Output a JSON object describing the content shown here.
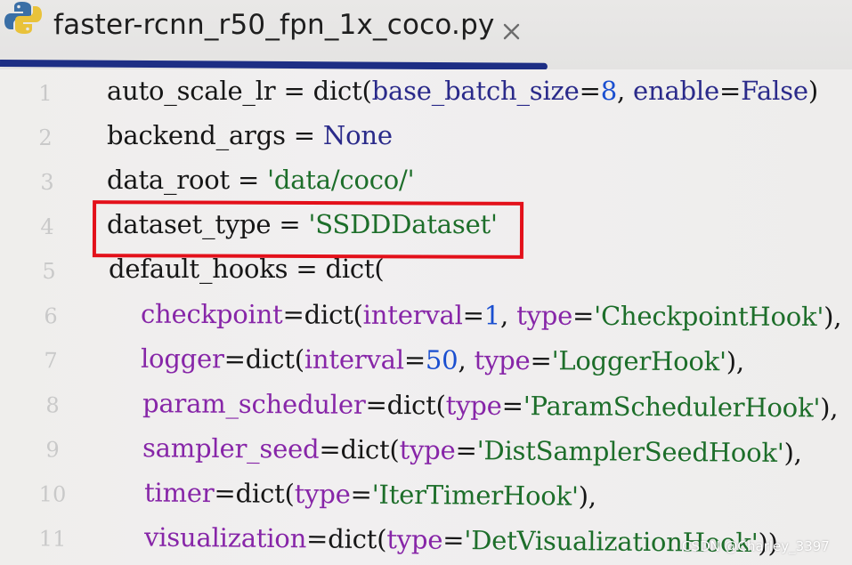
{
  "tab": {
    "title": "faster-rcnn_r50_fpn_1x_coco.py",
    "icon": "python-icon",
    "close_icon": "close-icon",
    "underline_color": "#1d2e84"
  },
  "lines": [
    {
      "number": "1",
      "tokens": [
        {
          "text": "auto_scale_lr",
          "color": "black"
        },
        {
          "text": " = ",
          "color": "black"
        },
        {
          "text": "dict",
          "color": "black"
        },
        {
          "text": "(",
          "color": "black"
        },
        {
          "text": "base_batch_size",
          "color": "navy"
        },
        {
          "text": "=",
          "color": "black"
        },
        {
          "text": "8",
          "color": "blue"
        },
        {
          "text": ", ",
          "color": "black"
        },
        {
          "text": "enable",
          "color": "navy"
        },
        {
          "text": "=",
          "color": "black"
        },
        {
          "text": "False",
          "color": "navy"
        },
        {
          "text": ")",
          "color": "black"
        }
      ]
    },
    {
      "number": "2",
      "tokens": [
        {
          "text": "backend_args",
          "color": "black"
        },
        {
          "text": " = ",
          "color": "black"
        },
        {
          "text": "None",
          "color": "navy"
        }
      ]
    },
    {
      "number": "3",
      "tokens": [
        {
          "text": "data_root",
          "color": "black"
        },
        {
          "text": " = ",
          "color": "black"
        },
        {
          "text": "'data/coco/'",
          "color": "str"
        }
      ]
    },
    {
      "number": "4",
      "tokens": [
        {
          "text": "dataset_type",
          "color": "black"
        },
        {
          "text": " = ",
          "color": "black"
        },
        {
          "text": "'SSDDDataset'",
          "color": "str"
        }
      ]
    },
    {
      "number": "5",
      "tokens": [
        {
          "text": "default_hooks",
          "color": "black"
        },
        {
          "text": " = ",
          "color": "black"
        },
        {
          "text": "dict",
          "color": "black"
        },
        {
          "text": "(",
          "color": "black"
        }
      ]
    },
    {
      "number": "6",
      "tokens": [
        {
          "text": "checkpoint",
          "color": "purple"
        },
        {
          "text": "=",
          "color": "black"
        },
        {
          "text": "dict",
          "color": "black"
        },
        {
          "text": "(",
          "color": "black"
        },
        {
          "text": "interval",
          "color": "purple"
        },
        {
          "text": "=",
          "color": "black"
        },
        {
          "text": "1",
          "color": "blue"
        },
        {
          "text": ", ",
          "color": "black"
        },
        {
          "text": "type",
          "color": "purple"
        },
        {
          "text": "=",
          "color": "black"
        },
        {
          "text": "'CheckpointHook'",
          "color": "str"
        },
        {
          "text": "),",
          "color": "black"
        }
      ]
    },
    {
      "number": "7",
      "tokens": [
        {
          "text": "logger",
          "color": "purple"
        },
        {
          "text": "=",
          "color": "black"
        },
        {
          "text": "dict",
          "color": "black"
        },
        {
          "text": "(",
          "color": "black"
        },
        {
          "text": "interval",
          "color": "purple"
        },
        {
          "text": "=",
          "color": "black"
        },
        {
          "text": "50",
          "color": "blue"
        },
        {
          "text": ", ",
          "color": "black"
        },
        {
          "text": "type",
          "color": "purple"
        },
        {
          "text": "=",
          "color": "black"
        },
        {
          "text": "'LoggerHook'",
          "color": "str"
        },
        {
          "text": "),",
          "color": "black"
        }
      ]
    },
    {
      "number": "8",
      "tokens": [
        {
          "text": "param_scheduler",
          "color": "purple"
        },
        {
          "text": "=",
          "color": "black"
        },
        {
          "text": "dict",
          "color": "black"
        },
        {
          "text": "(",
          "color": "black"
        },
        {
          "text": "type",
          "color": "purple"
        },
        {
          "text": "=",
          "color": "black"
        },
        {
          "text": "'ParamSchedulerHook'",
          "color": "str"
        },
        {
          "text": "),",
          "color": "black"
        }
      ]
    },
    {
      "number": "9",
      "tokens": [
        {
          "text": "sampler_seed",
          "color": "purple"
        },
        {
          "text": "=",
          "color": "black"
        },
        {
          "text": "dict",
          "color": "black"
        },
        {
          "text": "(",
          "color": "black"
        },
        {
          "text": "type",
          "color": "purple"
        },
        {
          "text": "=",
          "color": "black"
        },
        {
          "text": "'DistSamplerSeedHook'",
          "color": "str"
        },
        {
          "text": "),",
          "color": "black"
        }
      ]
    },
    {
      "number": "10",
      "tokens": [
        {
          "text": "timer",
          "color": "purple"
        },
        {
          "text": "=",
          "color": "black"
        },
        {
          "text": "dict",
          "color": "black"
        },
        {
          "text": "(",
          "color": "black"
        },
        {
          "text": "type",
          "color": "purple"
        },
        {
          "text": "=",
          "color": "black"
        },
        {
          "text": "'IterTimerHook'",
          "color": "str"
        },
        {
          "text": "),",
          "color": "black"
        }
      ]
    },
    {
      "number": "11",
      "tokens": [
        {
          "text": "visualization",
          "color": "purple"
        },
        {
          "text": "=",
          "color": "black"
        },
        {
          "text": "dict",
          "color": "black"
        },
        {
          "text": "(",
          "color": "black"
        },
        {
          "text": "type",
          "color": "purple"
        },
        {
          "text": "=",
          "color": "black"
        },
        {
          "text": "'DetVisualizationHook'",
          "color": "str"
        },
        {
          "text": "))",
          "color": "black"
        }
      ]
    }
  ],
  "highlight_color": "#e3101a",
  "watermark": "CSDN @Charley_3397"
}
